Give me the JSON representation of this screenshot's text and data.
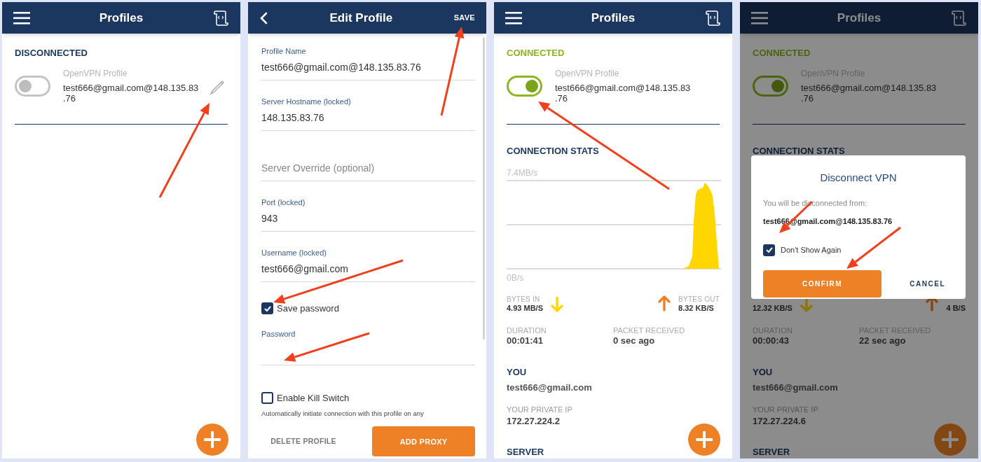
{
  "screens": [
    {
      "kind": "profiles",
      "title": "Profiles",
      "status": {
        "label": "DISCONNECTED",
        "connected": false
      },
      "profile": {
        "type": "OpenVPN Profile",
        "name": "test666@gmail.com@148.135.83\n.76",
        "on": false,
        "editable": true
      }
    },
    {
      "kind": "edit",
      "title": "Edit Profile",
      "action": "SAVE",
      "fields": [
        {
          "label": "Profile Name",
          "value": "test666@gmail.com@148.135.83.76"
        },
        {
          "label": "Server Hostname (locked)",
          "value": "148.135.83.76"
        },
        {
          "placeholder": "Server Override (optional)"
        },
        {
          "label": "Port (locked)",
          "value": "943"
        },
        {
          "label": "Username (locked)",
          "value": "test666@gmail.com"
        }
      ],
      "save_password": {
        "label": "Save password",
        "checked": true
      },
      "password": {
        "label": "Password"
      },
      "kill_switch": {
        "label": "Enable Kill Switch",
        "checked": false,
        "description": "Automatically initiate connection with this profile on any"
      },
      "buttons": [
        {
          "label": "DELETE PROFILE",
          "kind": "text"
        },
        {
          "label": "ADD PROXY",
          "kind": "filled"
        }
      ]
    },
    {
      "kind": "profiles",
      "title": "Profiles",
      "status": {
        "label": "CONNECTED",
        "connected": true
      },
      "profile": {
        "type": "OpenVPN Profile",
        "name": "test666@gmail.com@148.135.83\n.76",
        "on": true,
        "editable": false
      },
      "stats": {
        "heading": "CONNECTION STATS",
        "axis_max": "7.4MB/s",
        "axis_min": "0B/s",
        "bytes_in": {
          "label": "BYTES IN",
          "value": "4.93 MB/S"
        },
        "bytes_out": {
          "label": "BYTES OUT",
          "value": "8.32 KB/S"
        },
        "duration": {
          "label": "DURATION",
          "value": "00:01:41"
        },
        "packet": {
          "label": "PACKET RECEIVED",
          "value": "0 sec ago"
        }
      },
      "you": {
        "heading": "YOU",
        "user": "test666@gmail.com",
        "ip_label": "YOUR PRIVATE IP",
        "ip": "172.27.224.2"
      },
      "server": {
        "heading": "SERVER"
      }
    },
    {
      "kind": "profiles",
      "title": "Profiles",
      "status": {
        "label": "CONNECTED",
        "connected": true
      },
      "profile": {
        "type": "OpenVPN Profile",
        "name": "test666@gmail.com@148.135.83\n.76",
        "on": true,
        "editable": false
      },
      "stats": {
        "heading": "CONNECTION STATS",
        "bytes_in": {
          "value": "12.32 KB/S"
        },
        "bytes_out": {
          "value": "4 B/S"
        },
        "duration": {
          "label": "DURATION",
          "value": "00:00:43"
        },
        "packet": {
          "label": "PACKET RECEIVED",
          "value": "22 sec ago"
        }
      },
      "you": {
        "heading": "YOU",
        "user": "test666@gmail.com",
        "ip_label": "YOUR PRIVATE IP",
        "ip": "172.27.224.6"
      },
      "server": {
        "heading": "SERVER"
      },
      "dialog": {
        "title": "Disconnect VPN",
        "message": "You will be disconnected from:",
        "target": "test666@gmail.com@148.135.83.76",
        "checkbox": {
          "label": "Don't Show Again",
          "checked": true
        },
        "buttons": [
          {
            "label": "CONFIRM",
            "kind": "filled"
          },
          {
            "label": "CANCEL",
            "kind": "text"
          }
        ]
      }
    }
  ]
}
